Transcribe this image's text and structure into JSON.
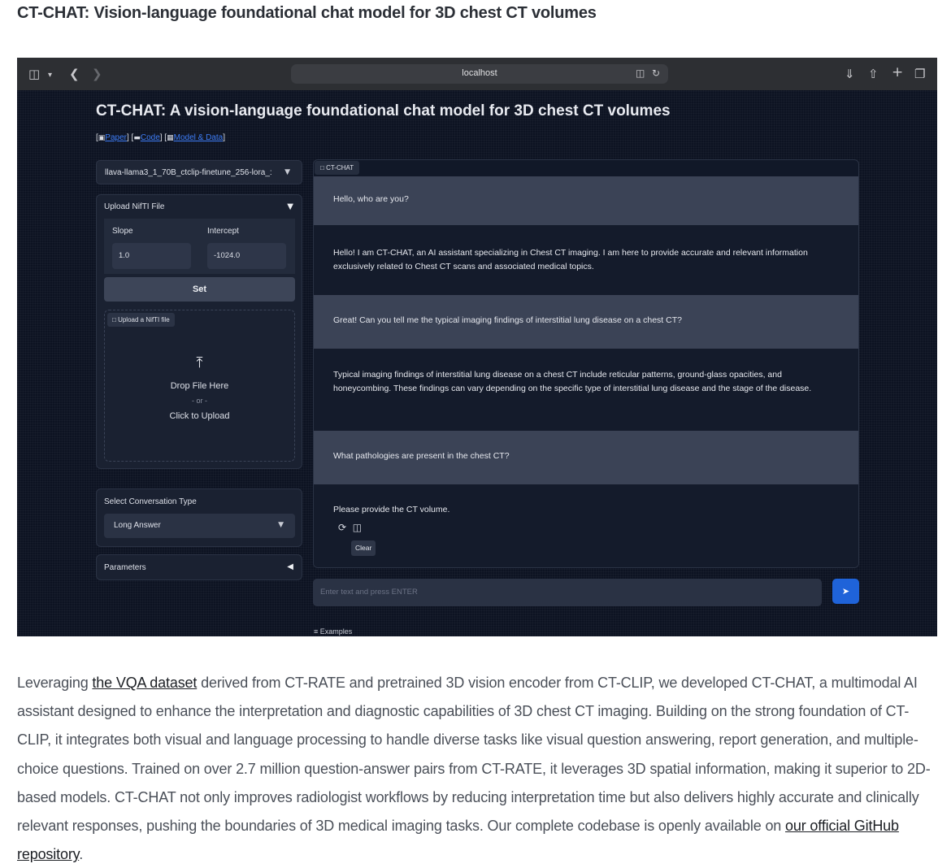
{
  "heading": "CT-CHAT: Vision-language foundational chat model for 3D chest CT volumes",
  "browser": {
    "address": "localhost",
    "icons": {
      "sidebar": "sidebar-icon",
      "back": "back-icon",
      "forward": "forward-icon",
      "translate": "translate-icon",
      "reload": "reload-icon",
      "download": "download-icon",
      "share": "share-icon",
      "new_tab": "plus-icon",
      "tabs": "tabs-overview-icon"
    }
  },
  "app": {
    "title": "CT-CHAT: A vision-language foundational chat model for 3D chest CT volumes",
    "links": {
      "paper": "Paper",
      "code": "Code",
      "model_data": "Model & Data"
    },
    "model_select": "llava-llama3_1_70B_ctclip-finetune_256-lora_:",
    "upload_panel": {
      "title": "Upload NifTI File",
      "slope_label": "Slope",
      "slope_value": "1.0",
      "intercept_label": "Intercept",
      "intercept_value": "-1024.0",
      "set_button": "Set",
      "file_tag": "Upload a NifTI file",
      "drop_text": "Drop File Here",
      "or_text": "- or -",
      "click_text": "Click to Upload"
    },
    "conversation": {
      "label": "Select Conversation Type",
      "value": "Long Answer"
    },
    "parameters_label": "Parameters",
    "chat": {
      "tag": "CT-CHAT",
      "messages": [
        {
          "role": "user",
          "text": "Hello, who are you?"
        },
        {
          "role": "bot",
          "text": "Hello! I am CT-CHAT, an AI assistant specializing in Chest CT imaging. I am here to provide accurate and relevant information exclusively related to Chest CT scans and associated medical topics."
        },
        {
          "role": "user",
          "text": "Great! Can you tell me the typical imaging findings of interstitial lung disease on a chest CT?"
        },
        {
          "role": "bot",
          "text": "Typical imaging findings of interstitial lung disease on a chest CT include reticular patterns, ground-glass opacities, and honeycombing. These findings can vary depending on the specific type of interstitial lung disease and the stage of the disease."
        },
        {
          "role": "user",
          "text": "What pathologies are present in the chest CT?"
        },
        {
          "role": "bot",
          "text": "Please provide the CT volume."
        }
      ],
      "clear_tooltip": "Clear"
    },
    "input_placeholder": "Enter text and press ENTER",
    "examples_label": "Examples"
  },
  "description": {
    "before_link1": "Leveraging ",
    "link1": "the VQA dataset",
    "middle": " derived from CT-RATE and pretrained 3D vision encoder from CT-CLIP, we developed CT-CHAT, a multimodal AI assistant designed to enhance the interpretation and diagnostic capabilities of 3D chest CT imaging. Building on the strong foundation of CT-CLIP, it integrates both visual and language processing to handle diverse tasks like visual question answering, report generation, and multiple-choice questions. Trained on over 2.7 million question-answer pairs from CT-RATE, it leverages 3D spatial information, making it superior to 2D-based models. CT-CHAT not only improves radiologist workflows by reducing interpretation time but also delivers highly accurate and clinically relevant responses, pushing the boundaries of 3D medical imaging tasks. Our complete codebase is openly available on ",
    "link2": "our official GitHub repository",
    "after": "."
  }
}
